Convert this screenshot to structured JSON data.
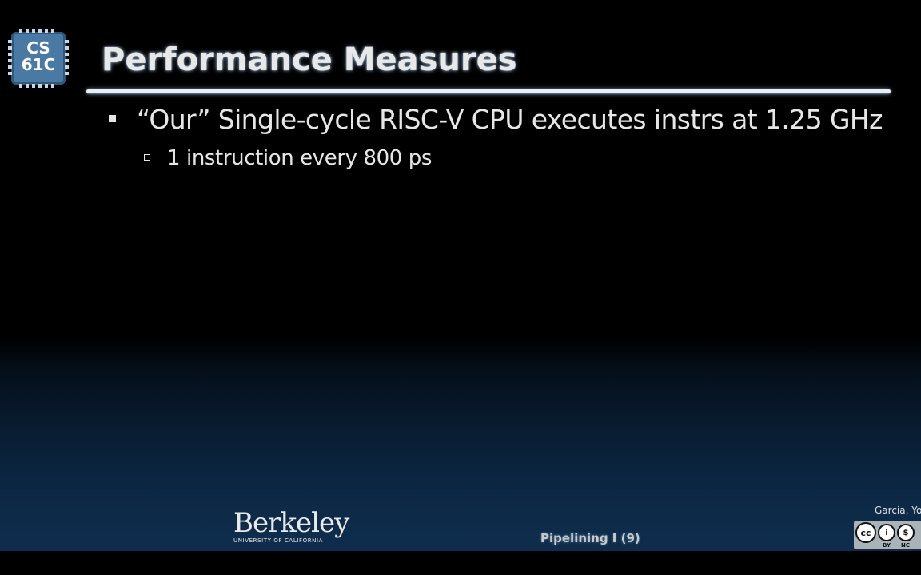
{
  "logo": {
    "line1": "CS",
    "line2": "61C"
  },
  "slide": {
    "title": "Performance Measures",
    "bullets": [
      {
        "text": "“Our” Single-cycle RISC-V CPU executes instrs at 1.25 GHz"
      },
      {
        "text": "1 instruction every 800 ps"
      }
    ]
  },
  "footer": {
    "berkeley_word": "Berkeley",
    "berkeley_sub": "UNIVERSITY OF CALIFORNIA",
    "section_label": "Pipelining I (9)",
    "author": "Garcia, Yo",
    "cc_icon_main": "cc",
    "cc_by_glyph": "i",
    "cc_nc_glyph": "$",
    "cc_labels": [
      "BY",
      "NC"
    ]
  },
  "icons": {
    "logo": "chip-logo-icon",
    "bullet1": "square-bullet-icon",
    "bullet2": "hollow-square-bullet-icon",
    "cc": "creative-commons-icon"
  },
  "colors": {
    "title": "#e8e8e8",
    "text": "#e6e6e6",
    "rule": "#e6eef6",
    "logo_chip": "#4a7aa3",
    "background_bottom": "#0e2d4d"
  }
}
